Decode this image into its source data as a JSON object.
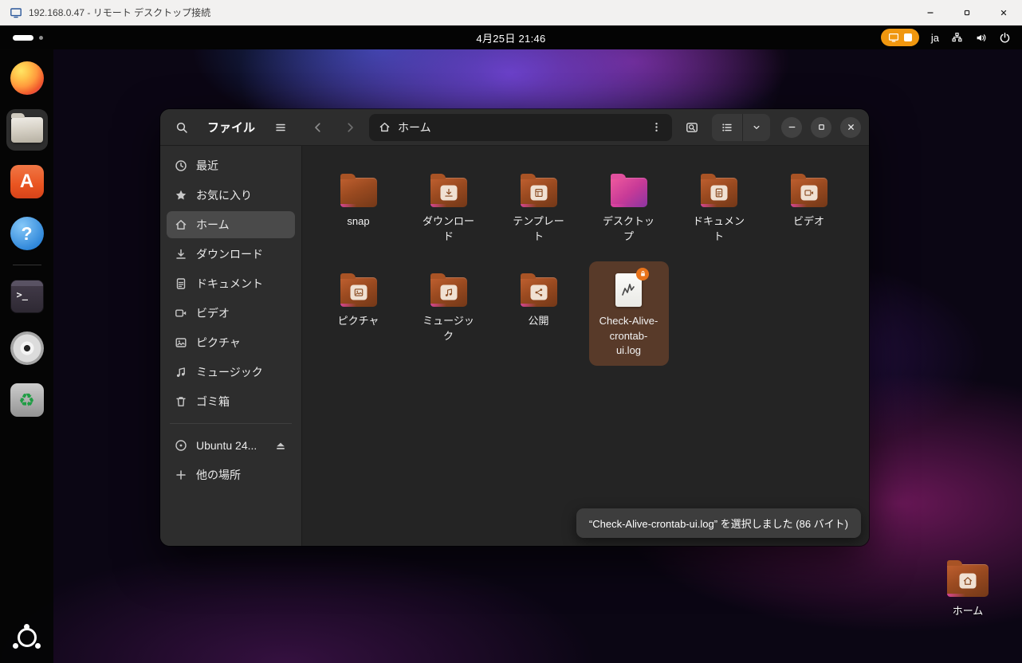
{
  "colors": {
    "accent_orange": "#e8731a",
    "indicator_orange": "#f0970f",
    "selection_brown": "#583a29",
    "folder_orange": "#9a4a20",
    "folder_accent": "#c73a97",
    "toast_gray": "#3d3d3d"
  },
  "rdp_titlebar": {
    "title": "192.168.0.47 - リモート デスクトップ接続"
  },
  "topbar": {
    "clock": "4月25日 21:46",
    "input_indicator": "ja"
  },
  "dock": {
    "items": [
      {
        "icon": "firefox-icon"
      },
      {
        "icon": "files-icon",
        "active": true
      },
      {
        "icon": "ubuntu-software-icon"
      },
      {
        "icon": "help-icon"
      },
      {
        "separator": true
      },
      {
        "icon": "terminal-icon"
      },
      {
        "icon": "disc-icon"
      },
      {
        "icon": "software-updater-icon"
      }
    ]
  },
  "files_window": {
    "title": "ファイル",
    "location": "ホーム",
    "sidebar": {
      "items": [
        {
          "icon": "clock",
          "label": "最近"
        },
        {
          "icon": "star",
          "label": "お気に入り"
        },
        {
          "icon": "home",
          "label": "ホーム",
          "selected": true
        },
        {
          "icon": "download",
          "label": "ダウンロード"
        },
        {
          "icon": "document",
          "label": "ドキュメント"
        },
        {
          "icon": "video",
          "label": "ビデオ"
        },
        {
          "icon": "picture",
          "label": "ピクチャ"
        },
        {
          "icon": "music",
          "label": "ミュージック"
        },
        {
          "icon": "trash",
          "label": "ゴミ箱"
        },
        {
          "separator": true
        },
        {
          "icon": "disc",
          "label": "Ubuntu 24...",
          "eject": true
        },
        {
          "icon": "plus",
          "label": "他の場所"
        }
      ]
    },
    "grid": {
      "items": [
        {
          "label": "snap",
          "type": "folder"
        },
        {
          "label": "ダウンロード",
          "type": "folder",
          "emblem": "download"
        },
        {
          "label": "テンプレート",
          "type": "folder",
          "emblem": "template"
        },
        {
          "label": "デスクトップ",
          "type": "folder-accent"
        },
        {
          "label": "ドキュメント",
          "type": "folder",
          "emblem": "document"
        },
        {
          "label": "ビデオ",
          "type": "folder",
          "emblem": "video"
        },
        {
          "label": "ピクチャ",
          "type": "folder",
          "emblem": "picture"
        },
        {
          "label": "ミュージック",
          "type": "folder",
          "emblem": "music"
        },
        {
          "label": "公開",
          "type": "folder",
          "emblem": "share"
        },
        {
          "label": "Check-Alive-crontab-ui.log",
          "type": "file",
          "selected": true,
          "badge": "lock"
        }
      ]
    },
    "selection_toast": "“Check-Alive-crontab-ui.log” を選択しました (86 バイト)"
  },
  "desktop": {
    "home_label": "ホーム"
  }
}
